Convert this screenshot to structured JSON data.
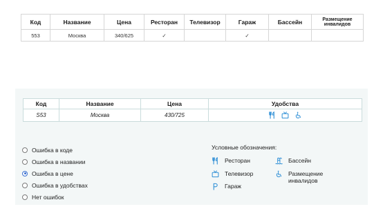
{
  "ref_table": {
    "headers": [
      "Код",
      "Название",
      "Цена",
      "Ресторан",
      "Телевизор",
      "Гараж",
      "Бассейн",
      "Размещение инвалидов"
    ],
    "row": {
      "code": "553",
      "name": "Москва",
      "price": "340/625",
      "restaurant": "✓",
      "tv": "",
      "garage": "✓",
      "pool": "",
      "disabled": ""
    }
  },
  "task_table": {
    "headers": [
      "Код",
      "Название",
      "Цена",
      "Удобства"
    ],
    "row": {
      "code": "S53",
      "name": "Москва",
      "price": "430/725",
      "amenities": [
        "restaurant-icon",
        "tv-icon",
        "wheelchair-icon"
      ]
    }
  },
  "options": [
    {
      "label": "Ошибка в коде",
      "selected": false
    },
    {
      "label": "Ошибка в названии",
      "selected": false
    },
    {
      "label": "Ошибка в цене",
      "selected": true
    },
    {
      "label": "Ошибка в удобствах",
      "selected": false
    },
    {
      "label": "Нет ошибок",
      "selected": false
    }
  ],
  "legend": {
    "title": "Условные обозначения:",
    "items": {
      "restaurant": "Ресторан",
      "pool": "Бассейн",
      "tv": "Телевизор",
      "disabled": "Размещение инвалидов",
      "garage": "Гараж"
    }
  },
  "colors": {
    "icon": "#2f8fd6",
    "panel_bg": "#f3f7f7",
    "radio_selected": "#3a6fd0"
  }
}
